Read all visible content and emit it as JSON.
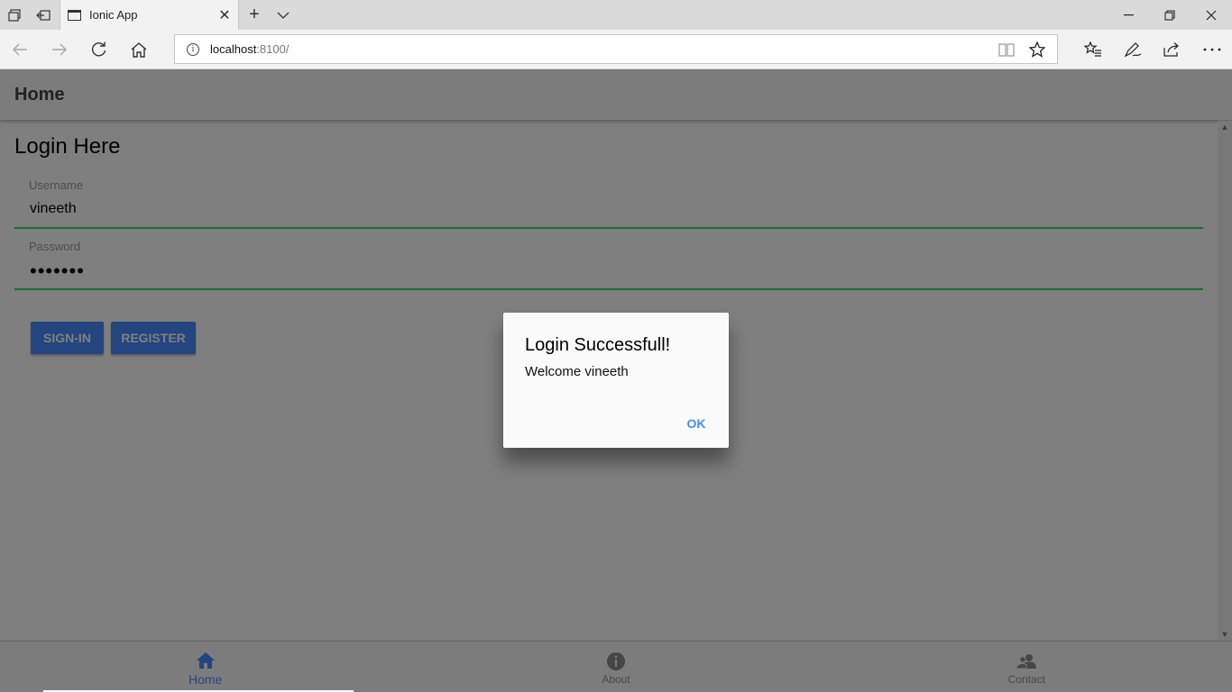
{
  "browser": {
    "tab_title": "Ionic App",
    "url_host": "localhost",
    "url_path": ":8100/",
    "colors": {
      "chrome": "#f2f2f2",
      "tabbar": "#dadada"
    }
  },
  "app": {
    "header_title": "Home",
    "login_title": "Login Here",
    "username": {
      "label": "Username",
      "value": "vineeth"
    },
    "password": {
      "label": "Password",
      "value": "•••••••"
    },
    "buttons": {
      "signin": "SIGN-IN",
      "register": "REGISTER"
    },
    "tabs": [
      {
        "label": "Home",
        "icon": "home-icon",
        "active": true
      },
      {
        "label": "About",
        "icon": "information-circle-icon",
        "active": false
      },
      {
        "label": "Contact",
        "icon": "contacts-icon",
        "active": false
      }
    ],
    "colors": {
      "primary": "#488aff",
      "valid_underline": "#32db64"
    }
  },
  "alert": {
    "title": "Login Successfull!",
    "message": "Welcome vineeth",
    "ok": "OK"
  }
}
